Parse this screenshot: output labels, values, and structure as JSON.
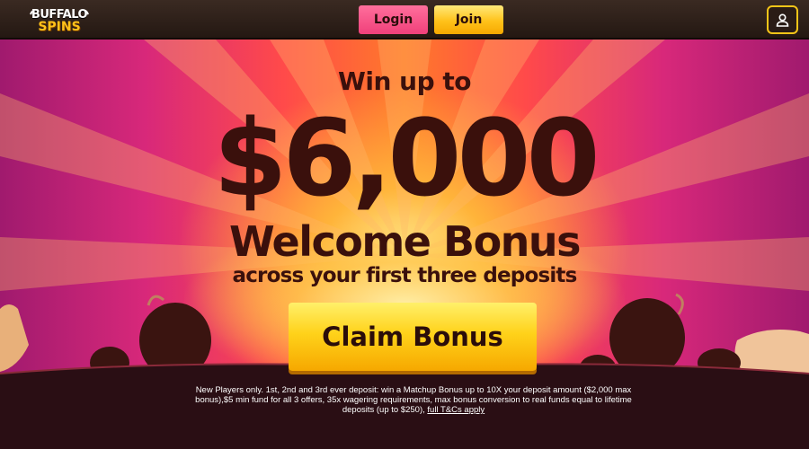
{
  "header": {
    "logo": {
      "line1": "BUFFALO",
      "line2": "SPINS"
    },
    "login_label": "Login",
    "join_label": "Join",
    "account_icon": "user-icon"
  },
  "hero": {
    "headline": "Win up to",
    "amount": "$6,000",
    "welcome": "Welcome Bonus",
    "subline": "across your first three deposits",
    "cta_label": "Claim Bonus",
    "terms_text": "New Players only. 1st, 2nd and 3rd ever deposit: win a Matchup Bonus up to 10X your deposit amount ($2,000 max bonus),$5 min fund for all 3 offers, 35x wagering requirements, max bonus conversion to real funds equal to lifetime deposits (up to $250),",
    "terms_link": "full T&Cs apply"
  },
  "colors": {
    "login_pink": "#f0407a",
    "join_yellow": "#ffc21a",
    "headline_text": "#3a100c",
    "account_border": "#f5c518"
  }
}
